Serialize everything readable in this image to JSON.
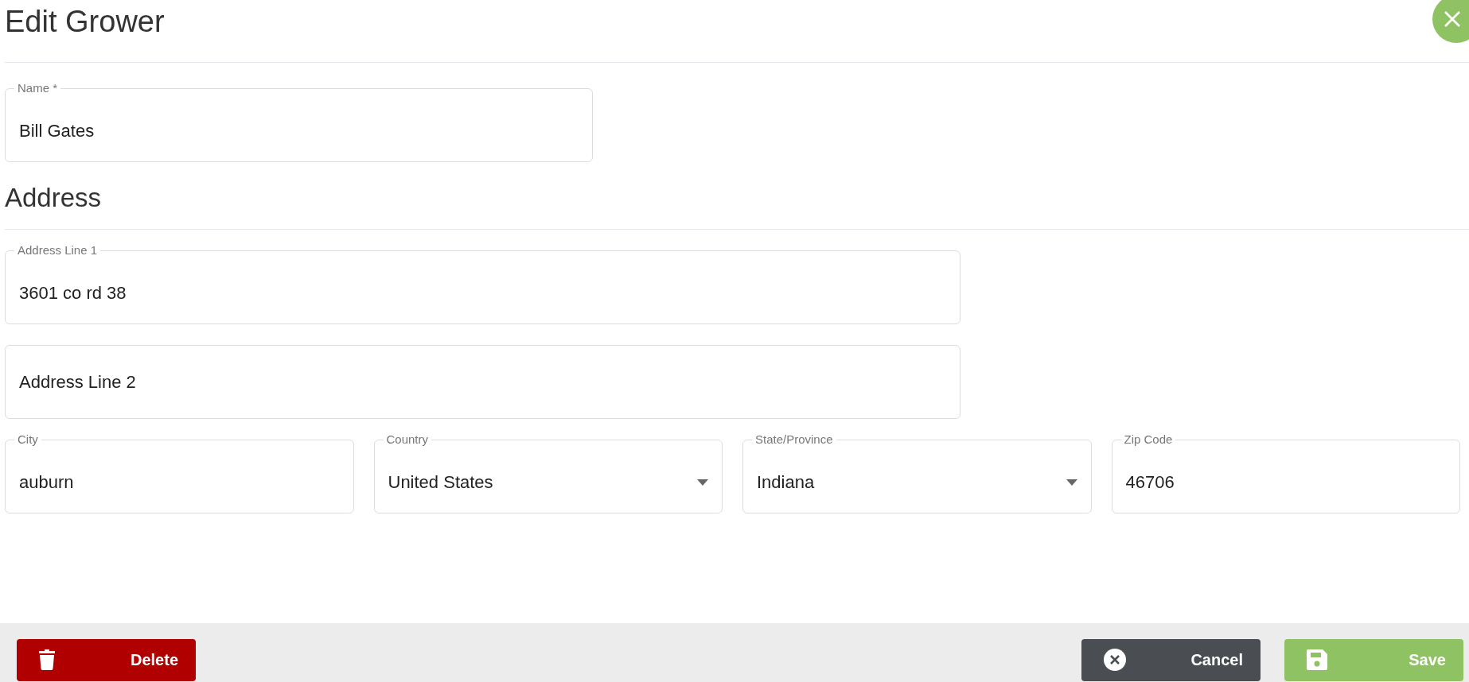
{
  "dialog": {
    "title": "Edit Grower"
  },
  "name_field": {
    "label": "Name *",
    "value": "Bill Gates"
  },
  "address": {
    "heading": "Address",
    "lines": [
      {
        "label": "Address Line 1",
        "value": "3601 co rd 38"
      },
      {
        "placeholder": "Address Line 2"
      }
    ],
    "row": [
      {
        "kind": "text",
        "label": "City",
        "value": "auburn"
      },
      {
        "kind": "select",
        "label": "Country",
        "value": "United States"
      },
      {
        "kind": "select",
        "label": "State/Province",
        "value": "Indiana"
      },
      {
        "kind": "text",
        "label": "Zip Code",
        "value": "46706"
      }
    ]
  },
  "footer": {
    "buttons": [
      {
        "kind": "delete",
        "label": "Delete"
      },
      {
        "kind": "cancel",
        "label": "Cancel"
      },
      {
        "kind": "save",
        "label": "Save"
      }
    ]
  }
}
